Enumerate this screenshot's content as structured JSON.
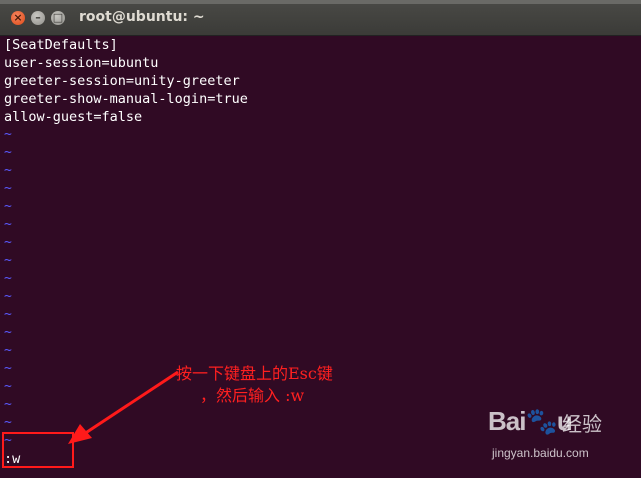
{
  "window": {
    "title": "root@ubuntu: ~"
  },
  "terminal": {
    "lines": [
      "[SeatDefaults]",
      "user-session=ubuntu",
      "greeter-session=unity-greeter",
      "greeter-show-manual-login=true",
      "allow-guest=false"
    ],
    "tilde": "~",
    "command": ":w"
  },
  "annotation": {
    "line1": "按一下键盘上的Esc键",
    "line2": "，然后输入 :w",
    "color": "#ff2020"
  },
  "watermark": {
    "logo": "Bai🐾u",
    "label": "经验",
    "url": "jingyan.baidu.com"
  },
  "colors": {
    "terminal_bg": "#300a24",
    "tilde": "#5a5aff",
    "close_button": "#df4a16"
  }
}
